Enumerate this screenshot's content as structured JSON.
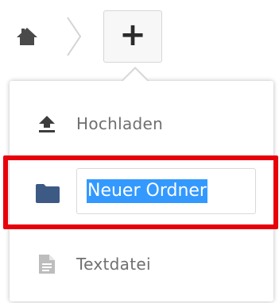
{
  "breadcrumb": {
    "home_icon": "home-icon",
    "separator_icon": "chevron-right-icon"
  },
  "new_button": {
    "label": "+",
    "icon": "plus-icon"
  },
  "menu": {
    "items": [
      {
        "label": "Hochladen",
        "icon": "upload-icon"
      },
      {
        "label": "",
        "icon": "folder-icon",
        "input_value": "Neuer Ordner"
      },
      {
        "label": "Textdatei",
        "icon": "text-file-icon"
      }
    ]
  },
  "colors": {
    "highlight": "#e8000b",
    "selection": "#3399ff",
    "folder": "#3d5a85",
    "text": "#6f6f6f",
    "icon_dark": "#3d3d3d"
  }
}
